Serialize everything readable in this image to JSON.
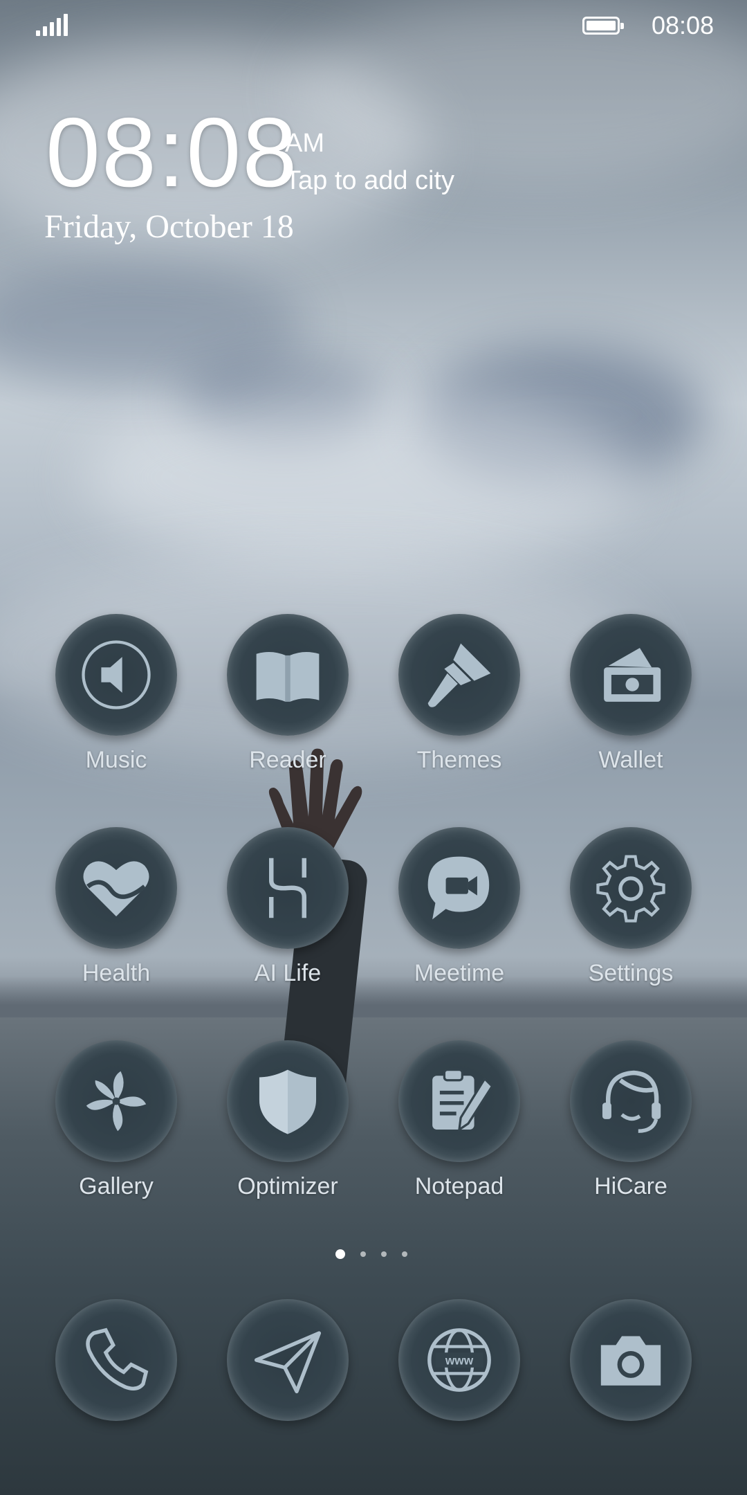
{
  "status_bar": {
    "time": "08:08",
    "signal_icon": "signal-bars-icon",
    "battery_icon": "battery-icon",
    "battery_level": 1.0
  },
  "lock_clock": {
    "time": "08:08",
    "ampm": "AM",
    "city_hint": "Tap to add city",
    "date": "Friday, October 18"
  },
  "apps": [
    {
      "label": "Music",
      "icon": "music-speaker-icon"
    },
    {
      "label": "Reader",
      "icon": "book-icon"
    },
    {
      "label": "Themes",
      "icon": "paintbrush-icon"
    },
    {
      "label": "Wallet",
      "icon": "wallet-icon"
    },
    {
      "label": "Health",
      "icon": "heart-icon"
    },
    {
      "label": "AI Life",
      "icon": "ai-life-icon"
    },
    {
      "label": "Meetime",
      "icon": "video-chat-icon"
    },
    {
      "label": "Settings",
      "icon": "gear-icon"
    },
    {
      "label": "Gallery",
      "icon": "flower-icon"
    },
    {
      "label": "Optimizer",
      "icon": "shield-icon"
    },
    {
      "label": "Notepad",
      "icon": "notepad-icon"
    },
    {
      "label": "HiCare",
      "icon": "headset-icon"
    }
  ],
  "page_indicator": {
    "pages": 4,
    "current": 1
  },
  "dock": [
    {
      "icon": "phone-icon"
    },
    {
      "icon": "send-icon"
    },
    {
      "icon": "browser-icon"
    },
    {
      "icon": "camera-icon"
    }
  ],
  "colors": {
    "icon_fill": "#aebfcb",
    "icon_bg": "#34434c",
    "label": "#dde4ea"
  }
}
